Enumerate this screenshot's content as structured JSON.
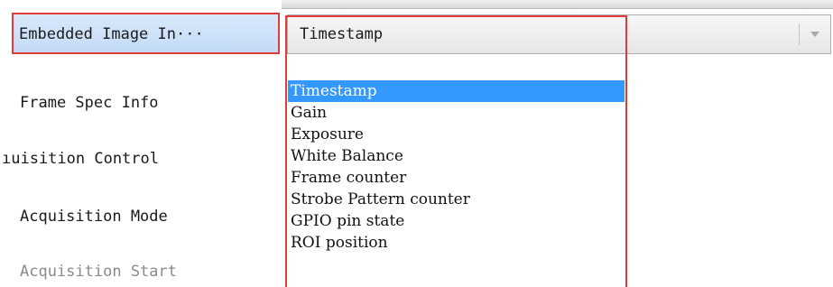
{
  "properties": {
    "items": [
      {
        "label": "Embedded Image In···"
      },
      {
        "label": "Frame Spec Info"
      },
      {
        "label": "ıuisition Control"
      },
      {
        "label": "Acquisition Mode"
      },
      {
        "label": "Acquisition Start"
      }
    ]
  },
  "combo": {
    "value": "Timestamp",
    "options": [
      "Timestamp",
      "Gain",
      "Exposure",
      "White Balance",
      "Frame counter",
      "Strobe Pattern counter",
      "GPIO pin state",
      "ROI position"
    ],
    "selected_index": 0
  },
  "colors": {
    "highlight_outline": "#e23b3b",
    "list_selection": "#3399ff",
    "row_selection": "#c3dbf7"
  }
}
